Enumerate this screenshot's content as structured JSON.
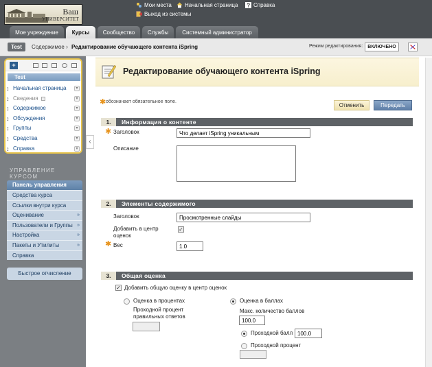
{
  "header": {
    "logo_line1": "Ваш",
    "logo_line2": "УНИВЕРСИТЕТ",
    "links": {
      "my_places": "Мои места",
      "home": "Начальная страница",
      "help": "Справка",
      "logout": "Выход из системы"
    }
  },
  "tabs": [
    {
      "label": "Мое учреждение",
      "active": false
    },
    {
      "label": "Курсы",
      "active": true
    },
    {
      "label": "Сообщество",
      "active": false
    },
    {
      "label": "Службы",
      "active": false
    },
    {
      "label": "Системный администратор",
      "active": false
    }
  ],
  "breadcrumb": {
    "course": "Test",
    "content": "Содержимое",
    "separator": "›",
    "current": "Редактирование обучающего контента iSpring",
    "edit_mode_label": "Режим редактирования:",
    "edit_mode_value": "ВКЛЮЧЕНО"
  },
  "course_menu": {
    "add_symbol": "+",
    "title": "Test",
    "items": [
      {
        "label": "Начальная страница",
        "hidden": false
      },
      {
        "label": "Сведения",
        "hidden": true
      },
      {
        "label": "Содержимое",
        "hidden": false
      },
      {
        "label": "Обсуждения",
        "hidden": false
      },
      {
        "label": "Группы",
        "hidden": false
      },
      {
        "label": "Средства",
        "hidden": false
      },
      {
        "label": "Справка",
        "hidden": false
      }
    ]
  },
  "management": {
    "title": "УПРАВЛЕНИЕ КУРСОМ",
    "panel_title": "Панель управления",
    "items": [
      {
        "label": "Средства курса",
        "submenu": false
      },
      {
        "label": "Ссылки внутри курса",
        "submenu": false
      },
      {
        "label": "Оценивание",
        "submenu": true
      },
      {
        "label": "Пользователи и Группы",
        "submenu": true
      },
      {
        "label": "Настройка",
        "submenu": true
      },
      {
        "label": "Пакеты и Утилиты",
        "submenu": true
      },
      {
        "label": "Справка",
        "submenu": false
      }
    ],
    "quick_report": "Быстрое отчисление"
  },
  "page": {
    "title": "Редактирование обучающего контента iSpring",
    "required_note": "обозначает обязательное поле.",
    "cancel": "Отменить",
    "submit": "Передать"
  },
  "section1": {
    "num": "1.",
    "title": "Информация о контенте",
    "title_label": "Заголовок",
    "title_value": "Что делает iSpring уникальным",
    "desc_label": "Описание"
  },
  "section2": {
    "num": "2.",
    "title": "Элементы содержимого",
    "title_label": "Заголовок",
    "title_value": "Просмотренные слайды",
    "add_grade_label": "Добавить в центр оценок",
    "add_grade_checked": true,
    "weight_label": "Вес",
    "weight_value": "1.0"
  },
  "section3": {
    "num": "3.",
    "title": "Общая оценка",
    "add_total_label": "Добавить общую оценку в центр оценок",
    "add_total_checked": true,
    "percent_label": "Оценка в процентах",
    "passing_percent_label": "Проходной процент правильных ответов",
    "points_label": "Оценка в баллах",
    "max_points_label": "Макс. количество баллов",
    "max_points_value": "100.0",
    "passing_score_label": "Проходной балл",
    "passing_score_value": "100.0",
    "passing_percent_option": "Проходной процент"
  }
}
